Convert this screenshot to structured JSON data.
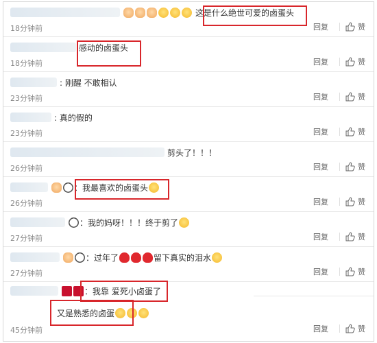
{
  "comments": [
    {
      "text": "这是什么绝世可爱的卤蛋头",
      "time": "18分钟前",
      "reply": "回复",
      "like": "赞"
    },
    {
      "text": "感动的卤蛋头",
      "time": "18分钟前",
      "reply": "回复",
      "like": "赞"
    },
    {
      "text": ": 刚醒 不敢相认",
      "time": "23分钟前",
      "reply": "回复",
      "like": "赞"
    },
    {
      "text": ": 真的假的",
      "time": "23分钟前",
      "reply": "回复",
      "like": "赞"
    },
    {
      "text": "剪头了！！！",
      "time": "26分钟前",
      "reply": "回复",
      "like": "赞"
    },
    {
      "text": "我最喜欢的卤蛋头",
      "prefix": "：",
      "time": "26分钟前",
      "reply": "回复",
      "like": "赞"
    },
    {
      "text": "：我的妈呀！！！终于剪了",
      "time": "27分钟前",
      "reply": "回复",
      "like": "赞"
    },
    {
      "text": "：过年了",
      "text2": "留下真实的泪水",
      "time": "27分钟前",
      "reply": "回复",
      "like": "赞"
    },
    {
      "text": "：我靠  爱死小卤蛋了",
      "time": "",
      "reply": "",
      "like": ""
    },
    {
      "text": "又是熟悉的卤蛋",
      "time": "45分钟前",
      "reply": "回复",
      "like": "赞"
    }
  ],
  "colors": {
    "highlight": "#d8262b",
    "time": "#888888",
    "action": "#666666"
  }
}
